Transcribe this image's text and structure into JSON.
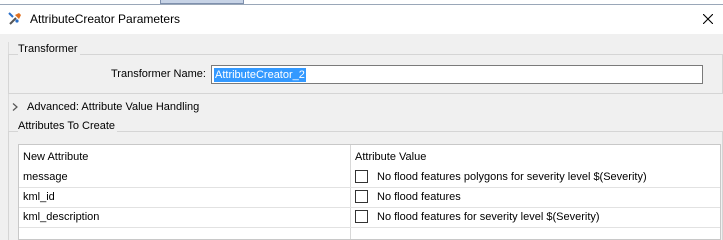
{
  "window": {
    "title": "AttributeCreator Parameters",
    "close_glyph": "✕"
  },
  "transformer": {
    "section_label": "Transformer",
    "name_label": "Transformer Name:",
    "name_value": "AttributeCreator_2"
  },
  "advanced": {
    "label": "Advanced: Attribute Value Handling"
  },
  "attributes": {
    "section_label": "Attributes To Create",
    "columns": [
      "New Attribute",
      "Attribute Value"
    ],
    "rows": [
      {
        "name": "message",
        "value": "No flood features polygons for severity level $(Severity)"
      },
      {
        "name": "kml_id",
        "value": "No flood features"
      },
      {
        "name": "kml_description",
        "value": "No flood features for severity level $(Severity)"
      }
    ]
  },
  "colors": {
    "selection": "#3399ff",
    "dialog_bg": "#f0f0f0"
  },
  "icons": {
    "title": "transformer-wrench-icon",
    "close": "close-icon",
    "expand": "chevron-right-icon",
    "checkbox": "checkbox-icon"
  }
}
